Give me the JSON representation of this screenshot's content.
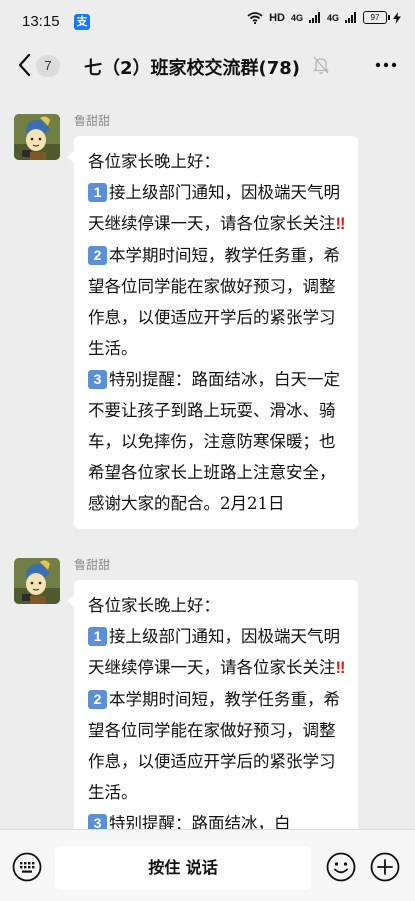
{
  "status_bar": {
    "time": "13:15",
    "app_badge": "支",
    "hd_label": "HD",
    "net1": "4G",
    "net2": "4G",
    "battery": "97"
  },
  "nav": {
    "unread": "7",
    "title": "七（2）班家校交流群(78)"
  },
  "messages": [
    {
      "sender": "鲁甜甜",
      "greeting": "各位家长晚上好：",
      "item1_num": "1",
      "item1_text": "接上级部门通知，因极端天气明天继续停课一天，请各位家长关注",
      "item1_mark": "!!",
      "item2_num": "2",
      "item2_text": "本学期时间短，教学任务重，希望各位同学能在家做好预习，调整作息，以便适应开学后的紧张学习生活。",
      "item3_num": "3",
      "item3_text": "特别提醒：路面结冰，白天一定不要让孩子到路上玩耍、滑冰、骑车，以免摔伤，注意防寒保暖；也希望各位家长上班路上注意安全，感谢大家的配合。2月21日"
    },
    {
      "sender": "鲁甜甜",
      "greeting": "各位家长晚上好：",
      "item1_num": "1",
      "item1_text": "接上级部门通知，因极端天气明天继续停课一天，请各位家长关注",
      "item1_mark": "!!",
      "item2_num": "2",
      "item2_text": "本学期时间短，教学任务重，希望各位同学能在家做好预习，调整作息，以便适应开学后的紧张学习生活。",
      "item3_num": "3",
      "item3_text": "特别提醒：路面结冰，白"
    }
  ],
  "input_bar": {
    "hold_to_talk": "按住 说话"
  },
  "icons": {
    "back": "back-chevron-icon",
    "mute": "bell-muted-icon",
    "more": "more-dots-icon",
    "keyboard": "keyboard-icon",
    "emoji": "emoji-icon",
    "plus": "plus-icon"
  },
  "colors": {
    "background": "#ededed",
    "bubble": "#ffffff",
    "number_badge": "#5b8fd6",
    "alert": "#e02020"
  }
}
